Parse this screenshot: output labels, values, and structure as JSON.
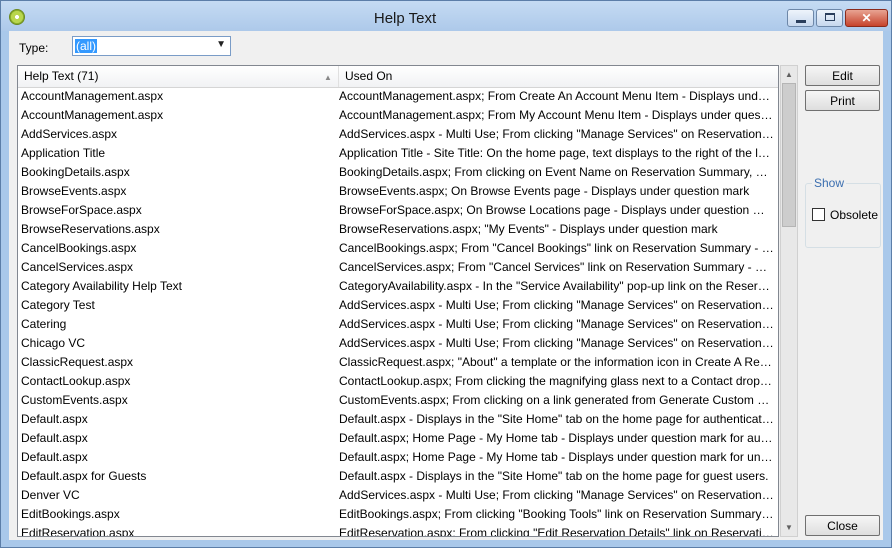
{
  "window": {
    "title": "Help Text",
    "controls": {
      "minimize": "",
      "maximize": "",
      "close": "✕"
    }
  },
  "type_filter": {
    "label": "Type:",
    "selected": "(all)"
  },
  "list": {
    "columns": [
      "Help Text (71)",
      "Used On"
    ],
    "rows": [
      {
        "name": "AccountManagement.aspx",
        "used_on": "AccountManagement.aspx; From Create An Account Menu Item - Displays under question mark"
      },
      {
        "name": "AccountManagement.aspx",
        "used_on": "AccountManagement.aspx; From My Account Menu Item - Displays under question mark"
      },
      {
        "name": "AddServices.aspx",
        "used_on": "AddServices.aspx - Multi Use; From clicking \"Manage Services\" on Reservation Summary page"
      },
      {
        "name": "Application Title",
        "used_on": "Application Title - Site Title: On the home page, text displays to the right of the logo"
      },
      {
        "name": "BookingDetails.aspx",
        "used_on": "BookingDetails.aspx; From clicking on Event Name on Reservation Summary, Browse Events"
      },
      {
        "name": "BrowseEvents.aspx",
        "used_on": "BrowseEvents.aspx; On Browse Events page - Displays under question mark"
      },
      {
        "name": "BrowseForSpace.aspx",
        "used_on": "BrowseForSpace.aspx; On Browse Locations page - Displays under question mark"
      },
      {
        "name": "BrowseReservations.aspx",
        "used_on": "BrowseReservations.aspx; \"My Events\" - Displays under question mark"
      },
      {
        "name": "CancelBookings.aspx",
        "used_on": "CancelBookings.aspx; From \"Cancel Bookings\" link on Reservation Summary - Displays under question mark"
      },
      {
        "name": "CancelServices.aspx",
        "used_on": "CancelServices.aspx; From \"Cancel Services\" link on Reservation Summary - Displays under question mark"
      },
      {
        "name": "Category Availability Help Text",
        "used_on": "CategoryAvailability.aspx - In the \"Service Availability\" pop-up link on the Reservation Summary"
      },
      {
        "name": "Category Test",
        "used_on": "AddServices.aspx - Multi Use; From clicking \"Manage Services\" on Reservation Summary page"
      },
      {
        "name": "Catering",
        "used_on": "AddServices.aspx - Multi Use; From clicking \"Manage Services\" on Reservation Summary page"
      },
      {
        "name": "Chicago VC",
        "used_on": "AddServices.aspx - Multi Use; From clicking \"Manage Services\" on Reservation Summary page"
      },
      {
        "name": "ClassicRequest.aspx",
        "used_on": "ClassicRequest.aspx; \"About\" a template or the information icon in Create A Reservation - Displays"
      },
      {
        "name": "ContactLookup.aspx",
        "used_on": "ContactLookup.aspx; From clicking the magnifying glass next to a Contact dropdown box - Displays"
      },
      {
        "name": "CustomEvents.aspx",
        "used_on": "CustomEvents.aspx; From clicking on a link generated from Generate Custom Link Menu - Displays"
      },
      {
        "name": "Default.aspx",
        "used_on": "Default.aspx - Displays in the \"Site Home\" tab on the home page for authenticated users."
      },
      {
        "name": "Default.aspx",
        "used_on": "Default.aspx; Home Page - My Home tab - Displays under question mark for authenticated users"
      },
      {
        "name": "Default.aspx",
        "used_on": "Default.aspx; Home Page - My Home tab - Displays under question mark for unauthenticated users"
      },
      {
        "name": "Default.aspx for Guests",
        "used_on": "Default.aspx - Displays in the \"Site Home\" tab on the home page for guest users."
      },
      {
        "name": "Denver VC",
        "used_on": "AddServices.aspx - Multi Use; From clicking \"Manage Services\" on Reservation Summary page"
      },
      {
        "name": "EditBookings.aspx",
        "used_on": "EditBookings.aspx; From clicking \"Booking Tools\" link on Reservation Summary - Displays under question mark"
      },
      {
        "name": "EditReservation.aspx",
        "used_on": "EditReservation.aspx; From clicking \"Edit Reservation Details\" link on Reservation Summary"
      }
    ]
  },
  "buttons": {
    "edit": "Edit",
    "print": "Print",
    "close": "Close"
  },
  "show_group": {
    "legend": "Show",
    "obsolete_label": "Obsolete",
    "obsolete_checked": false
  }
}
